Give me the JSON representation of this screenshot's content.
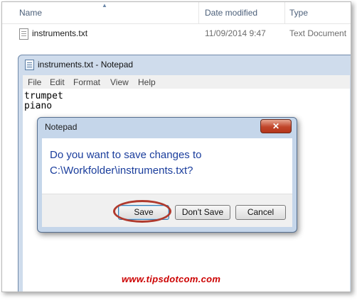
{
  "explorer": {
    "columns": {
      "name": "Name",
      "date": "Date modified",
      "type": "Type"
    },
    "file": {
      "name": "instruments.txt",
      "date": "11/09/2014 9:47",
      "type": "Text Document"
    }
  },
  "notepad": {
    "title": "instruments.txt - Notepad",
    "menu": [
      "File",
      "Edit",
      "Format",
      "View",
      "Help"
    ],
    "content": [
      "trumpet",
      "piano"
    ]
  },
  "dialog": {
    "title": "Notepad",
    "close_glyph": "✕",
    "message_line1": "Do you want to save changes to",
    "message_line2": "C:\\Workfolder\\instruments.txt?",
    "buttons": {
      "save": "Save",
      "dont_save": "Don't Save",
      "cancel": "Cancel"
    }
  },
  "watermark": "www.tipsdotcom.com",
  "colors": {
    "dialog_message": "#1a3d9c",
    "highlight": "#b03a2e",
    "watermark": "#cc0000"
  }
}
